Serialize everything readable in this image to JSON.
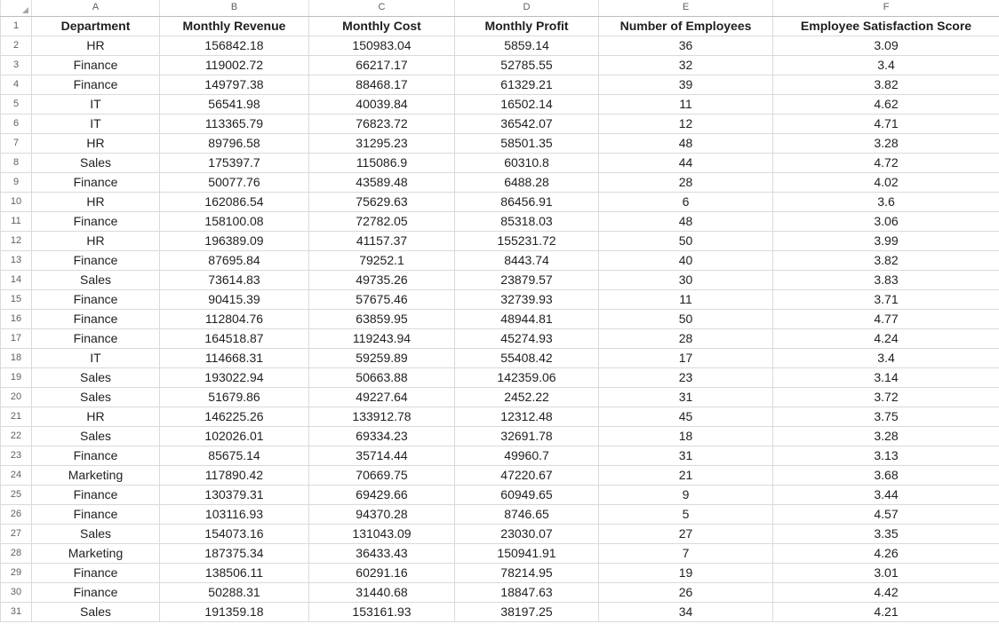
{
  "sheet": {
    "columns": [
      "A",
      "B",
      "C",
      "D",
      "E",
      "F"
    ],
    "header": [
      "Department",
      "Monthly Revenue",
      "Monthly Cost",
      "Monthly Profit",
      "Number of Employees",
      "Employee Satisfaction Score"
    ],
    "header_row_number": "1",
    "rows": [
      {
        "n": "2",
        "cells": [
          "HR",
          "156842.18",
          "150983.04",
          "5859.14",
          "36",
          "3.09"
        ]
      },
      {
        "n": "3",
        "cells": [
          "Finance",
          "119002.72",
          "66217.17",
          "52785.55",
          "32",
          "3.4"
        ]
      },
      {
        "n": "4",
        "cells": [
          "Finance",
          "149797.38",
          "88468.17",
          "61329.21",
          "39",
          "3.82"
        ]
      },
      {
        "n": "5",
        "cells": [
          "IT",
          "56541.98",
          "40039.84",
          "16502.14",
          "11",
          "4.62"
        ]
      },
      {
        "n": "6",
        "cells": [
          "IT",
          "113365.79",
          "76823.72",
          "36542.07",
          "12",
          "4.71"
        ]
      },
      {
        "n": "7",
        "cells": [
          "HR",
          "89796.58",
          "31295.23",
          "58501.35",
          "48",
          "3.28"
        ]
      },
      {
        "n": "8",
        "cells": [
          "Sales",
          "175397.7",
          "115086.9",
          "60310.8",
          "44",
          "4.72"
        ]
      },
      {
        "n": "9",
        "cells": [
          "Finance",
          "50077.76",
          "43589.48",
          "6488.28",
          "28",
          "4.02"
        ]
      },
      {
        "n": "10",
        "cells": [
          "HR",
          "162086.54",
          "75629.63",
          "86456.91",
          "6",
          "3.6"
        ]
      },
      {
        "n": "11",
        "cells": [
          "Finance",
          "158100.08",
          "72782.05",
          "85318.03",
          "48",
          "3.06"
        ]
      },
      {
        "n": "12",
        "cells": [
          "HR",
          "196389.09",
          "41157.37",
          "155231.72",
          "50",
          "3.99"
        ]
      },
      {
        "n": "13",
        "cells": [
          "Finance",
          "87695.84",
          "79252.1",
          "8443.74",
          "40",
          "3.82"
        ]
      },
      {
        "n": "14",
        "cells": [
          "Sales",
          "73614.83",
          "49735.26",
          "23879.57",
          "30",
          "3.83"
        ]
      },
      {
        "n": "15",
        "cells": [
          "Finance",
          "90415.39",
          "57675.46",
          "32739.93",
          "11",
          "3.71"
        ]
      },
      {
        "n": "16",
        "cells": [
          "Finance",
          "112804.76",
          "63859.95",
          "48944.81",
          "50",
          "4.77"
        ]
      },
      {
        "n": "17",
        "cells": [
          "Finance",
          "164518.87",
          "119243.94",
          "45274.93",
          "28",
          "4.24"
        ]
      },
      {
        "n": "18",
        "cells": [
          "IT",
          "114668.31",
          "59259.89",
          "55408.42",
          "17",
          "3.4"
        ]
      },
      {
        "n": "19",
        "cells": [
          "Sales",
          "193022.94",
          "50663.88",
          "142359.06",
          "23",
          "3.14"
        ]
      },
      {
        "n": "20",
        "cells": [
          "Sales",
          "51679.86",
          "49227.64",
          "2452.22",
          "31",
          "3.72"
        ]
      },
      {
        "n": "21",
        "cells": [
          "HR",
          "146225.26",
          "133912.78",
          "12312.48",
          "45",
          "3.75"
        ]
      },
      {
        "n": "22",
        "cells": [
          "Sales",
          "102026.01",
          "69334.23",
          "32691.78",
          "18",
          "3.28"
        ]
      },
      {
        "n": "23",
        "cells": [
          "Finance",
          "85675.14",
          "35714.44",
          "49960.7",
          "31",
          "3.13"
        ]
      },
      {
        "n": "24",
        "cells": [
          "Marketing",
          "117890.42",
          "70669.75",
          "47220.67",
          "21",
          "3.68"
        ]
      },
      {
        "n": "25",
        "cells": [
          "Finance",
          "130379.31",
          "69429.66",
          "60949.65",
          "9",
          "3.44"
        ]
      },
      {
        "n": "26",
        "cells": [
          "Finance",
          "103116.93",
          "94370.28",
          "8746.65",
          "5",
          "4.57"
        ]
      },
      {
        "n": "27",
        "cells": [
          "Sales",
          "154073.16",
          "131043.09",
          "23030.07",
          "27",
          "3.35"
        ]
      },
      {
        "n": "28",
        "cells": [
          "Marketing",
          "187375.34",
          "36433.43",
          "150941.91",
          "7",
          "4.26"
        ]
      },
      {
        "n": "29",
        "cells": [
          "Finance",
          "138506.11",
          "60291.16",
          "78214.95",
          "19",
          "3.01"
        ]
      },
      {
        "n": "30",
        "cells": [
          "Finance",
          "50288.31",
          "31440.68",
          "18847.63",
          "26",
          "4.42"
        ]
      },
      {
        "n": "31",
        "cells": [
          "Sales",
          "191359.18",
          "153161.93",
          "38197.25",
          "34",
          "4.21"
        ]
      }
    ]
  },
  "colors": {
    "gridline": "#dadada",
    "header_text": "#5f5f5f",
    "cell_text": "#1f1f1f"
  },
  "icons": {
    "corner": "select-all-triangle-icon"
  }
}
